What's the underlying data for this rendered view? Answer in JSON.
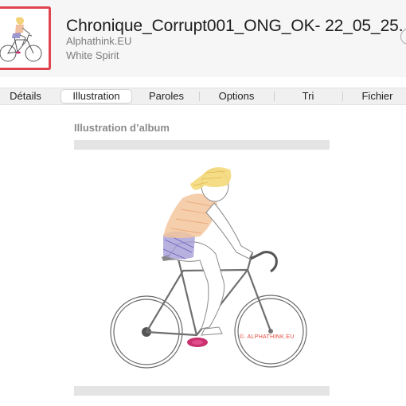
{
  "header": {
    "title": "Chronique_Corrupt001_ONG_OK- 22_05_25...",
    "artist": "Alphathink.EU",
    "album": "White Spirit"
  },
  "tabs": [
    {
      "label": "Détails",
      "active": false
    },
    {
      "label": "Illustration",
      "active": true
    },
    {
      "label": "Paroles",
      "active": false
    },
    {
      "label": "Options",
      "active": false
    },
    {
      "label": "Tri",
      "active": false
    },
    {
      "label": "Fichier",
      "active": false
    }
  ],
  "content": {
    "section_title": "Illustration d’album",
    "watermark": "©. ALPHATHINK.EU"
  },
  "colors": {
    "selection_border": "#e0444f",
    "watermark": "#e0473a"
  }
}
